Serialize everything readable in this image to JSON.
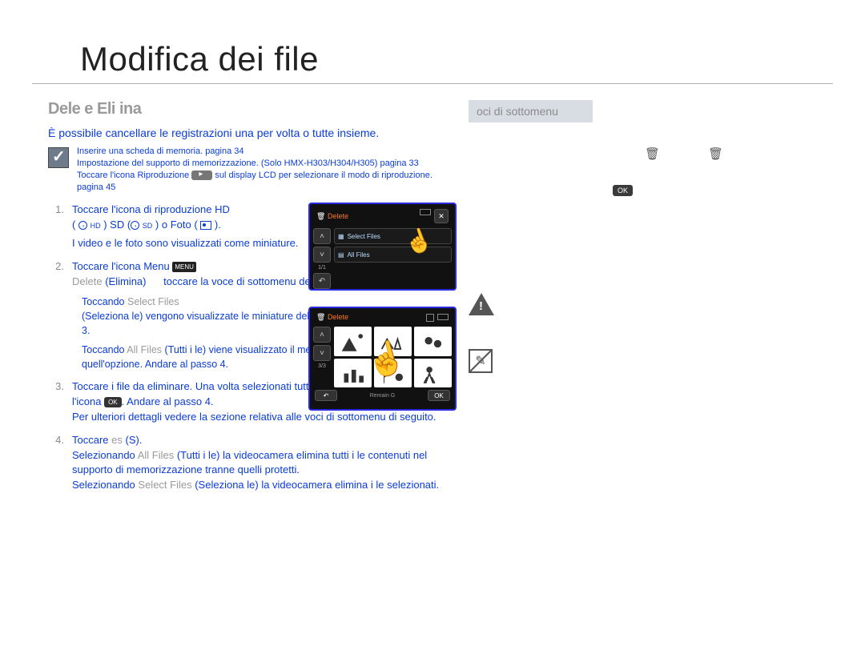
{
  "page_title": "Modifica dei file",
  "section_heading": "Dele e  Eli ina",
  "intro": "È possibile cancellare le registrazioni una per volta o tutte insieme.",
  "prereq": {
    "line1": "Inserire una scheda di memoria. pagina 34",
    "line2": "Impostazione del supporto di memorizzazione. (Solo HMX-H303/H304/H305) pagina 33",
    "line3a": "Toccare l'icona Riproduzione",
    "line3b": " sul display LCD per selezionare il modo di riproduzione. pagina 45"
  },
  "steps": [
    {
      "num": "1.",
      "l1": "Toccare l'icona di riproduzione HD",
      "l2a": "( ",
      "l2_hd": "HD",
      "l2b": " )  SD (",
      "l2_sd": "SD",
      "l2c": " ) o Foto ( ",
      "l2d": " ).",
      "l3": "I video e le foto sono visualizzati come miniature."
    },
    {
      "num": "2.",
      "l1a": "Toccare l'icona Menu ",
      "l1_menu": "MENU",
      "l1b": " ",
      "l2a": "Delete",
      "l2b": "(Elimina)",
      "l2c": "toccare la voce di sottomenu desiderata.",
      "sub1a": "Toccando ",
      "sub1b": "Select Files",
      "sub1c": "(Seleziona le) vengono visualizzate le miniature delle immagini. Andare al passo 3.",
      "sub2a": "Toccando ",
      "sub2b": "All Files",
      "sub2c": "(Tutti i le) viene visualizzato il messaggio corrispondente a quell'opzione. Andare al passo 4."
    },
    {
      "num": "3.",
      "l1a": "Toccare i file da eliminare. Una volta selezionati tutti i file da eliminare toccare l'icona ",
      "l1_ok": "OK",
      "l1b": ". Andare al passo 4.",
      "l2": "Per ulteriori dettagli vedere la sezione relativa alle voci di sottomenu di seguito."
    },
    {
      "num": "4.",
      "l1a": "Toccare ",
      "l1b": "es",
      "l1c": " (S).",
      "l2a": "Selezionando ",
      "l2b": "All Files",
      "l2c": " (Tutti i le) la videocamera elimina tutti i le contenuti nel supporto di memorizzazione tranne quelli protetti.",
      "l3a": "Selezionando ",
      "l3b": "Select Files",
      "l3c": " (Seleziona le) la videocamera elimina i le selezionati."
    }
  ],
  "camera": {
    "title1": "Delete",
    "opt1": "Select Files",
    "opt2": "All Files",
    "count": "1/1",
    "title2": "Delete",
    "page": "3/3",
    "remain": "Remain         G",
    "ok": "OK"
  },
  "right": {
    "submenu_header": "oci di sottomenu",
    "ok_chip": "OK"
  },
  "page_number": "  "
}
